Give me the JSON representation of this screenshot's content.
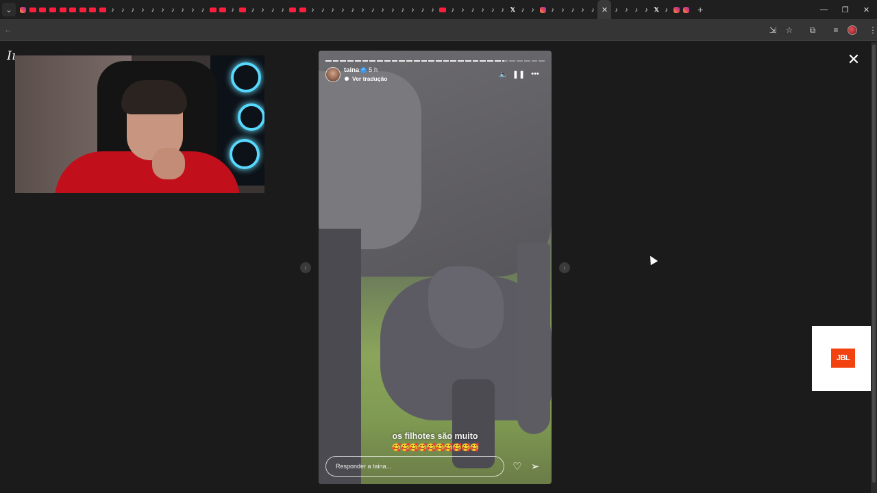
{
  "browser": {
    "tabs": [
      "instagram",
      "youtube",
      "youtube",
      "youtube",
      "youtube",
      "youtube",
      "youtube",
      "youtube",
      "youtube",
      "tiktok",
      "tiktok",
      "tiktok",
      "tiktok",
      "tiktok",
      "tiktok",
      "tiktok",
      "tiktok",
      "tiktok",
      "tiktok",
      "youtube",
      "youtube",
      "tiktok",
      "youtube",
      "tiktok",
      "tiktok",
      "tiktok",
      "tiktok",
      "youtube",
      "youtube",
      "tiktok",
      "tiktok",
      "tiktok",
      "tiktok",
      "tiktok",
      "tiktok",
      "tiktok",
      "tiktok",
      "tiktok",
      "tiktok",
      "tiktok",
      "tiktok",
      "tiktok",
      "youtube",
      "tiktok",
      "tiktok",
      "tiktok",
      "tiktok",
      "tiktok",
      "tiktok",
      "x",
      "tiktok",
      "tiktok",
      "instagram",
      "tiktok",
      "tiktok",
      "tiktok",
      "tiktok",
      "tiktok",
      "active",
      "tiktok",
      "tiktok",
      "tiktok",
      "tiktok",
      "x",
      "tiktok",
      "instagram",
      "instagram"
    ],
    "active_tab_close": "✕",
    "new_tab": "+",
    "tab_search": "⌄",
    "window_controls": [
      "—",
      "❐",
      "✕"
    ],
    "back": "←",
    "toolbar_icons": [
      "install-icon",
      "star-icon",
      "extensions-icon",
      "media-icon",
      "profile",
      "menu-icon"
    ]
  },
  "page": {
    "logo": "Iı"
  },
  "story": {
    "username": "taina",
    "verified": "✓",
    "time": "5 h",
    "translate": "Ver tradução",
    "caption": "os filhotes são muito",
    "emojis": "🥰🥰🥰🥰🥰🥰🥰🥰🥰🥰",
    "reply_placeholder": "Responder a taina...",
    "progress_segments_total": 30,
    "progress_current_segment": 24,
    "progress_current_fraction": 0.4
  },
  "nav": {
    "prev": "‹",
    "next": "›",
    "close": "✕"
  },
  "ad": {
    "brand": "JBL"
  }
}
